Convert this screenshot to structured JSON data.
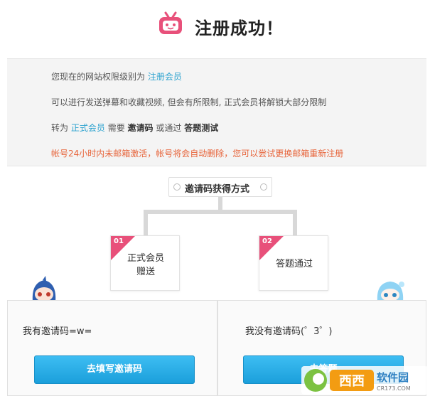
{
  "header": {
    "title": "注册成功！"
  },
  "info": {
    "line1_prefix": "您现在的网站权限级别为",
    "line1_level": "注册会员",
    "line2": "可以进行发送弹幕和收藏视频, 但会有所限制, 正式会员将解锁大部分限制",
    "line3_a": "转为",
    "line3_member": "正式会员",
    "line3_b": "需要",
    "line3_code": "邀请码",
    "line3_c": "或通过",
    "line3_test": "答题测试",
    "warning": "帐号24小时内未邮箱激活，帐号将会自动删除，您可以尝试更换邮箱重新注册"
  },
  "methods": {
    "label": "邀请码获得方式",
    "cards": [
      {
        "num": "01",
        "line1": "正式会员",
        "line2": "赠送"
      },
      {
        "num": "02",
        "line1": "答题通过",
        "line2": ""
      }
    ]
  },
  "panels": {
    "left_text": "我有邀请码=w=",
    "left_button": "去填写邀请码",
    "right_text": "我没有邀请码(゜3゜)",
    "right_button": "去答题"
  },
  "watermark": {
    "text1": "西西软件园",
    "text2": "CR173.COM"
  },
  "colors": {
    "accent_blue": "#2ea3cf",
    "warning": "#e7643a",
    "tag_pink": "#e8507a",
    "button_blue": "#1b9fdb"
  }
}
